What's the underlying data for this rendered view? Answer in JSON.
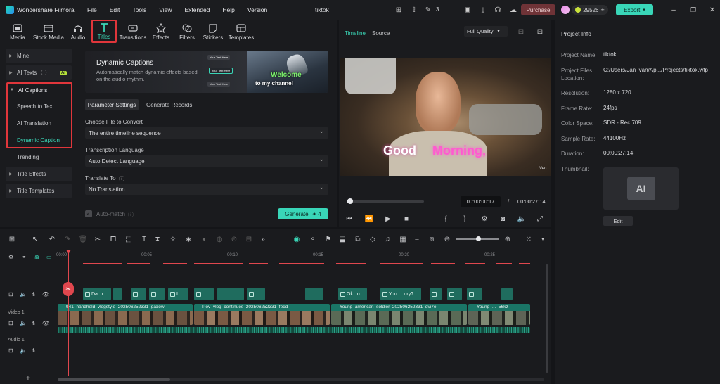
{
  "app": {
    "name": "Wondershare Filmora",
    "project": "tiktok",
    "menus": [
      "File",
      "Edit",
      "Tools",
      "View",
      "Extended",
      "Help",
      "Version"
    ],
    "purchase": "Purchase",
    "credits": "29526",
    "export": "Export",
    "notif_count": "3"
  },
  "toolbar": [
    "Media",
    "Stock Media",
    "Audio",
    "Titles",
    "Transitions",
    "Effects",
    "Filters",
    "Stickers",
    "Templates"
  ],
  "sidebar": {
    "mine": "Mine",
    "ai_texts": "AI Texts",
    "ai_badge": "AI",
    "ai_captions": "AI Captions",
    "sub": [
      "Speech to Text",
      "AI Translation",
      "Dynamic Caption"
    ],
    "trending": "Trending",
    "title_effects": "Title Effects",
    "title_templates": "Title Templates"
  },
  "banner": {
    "title": "Dynamic Captions",
    "desc": "Automatically match dynamic effects based on the audio rhythm.",
    "img_line1": "Welcome",
    "img_line2": "to my channel",
    "mini": [
      "Your Text Here",
      "Your Text Here",
      "Your Text Here"
    ]
  },
  "params": {
    "tab_active": "Parameter Settings",
    "tab_other": "Generate Records",
    "file_label": "Choose File to Convert",
    "file_value": "The entire timeline sequence",
    "lang_label": "Transcription Language",
    "lang_value": "Auto Detect Language",
    "translate_label": "Translate To",
    "translate_value": "No Translation",
    "automatch": "Auto-match",
    "generate": "Generate",
    "gen_cost": "4"
  },
  "preview": {
    "tab_timeline": "Timeline",
    "tab_source": "Source",
    "quality": "Full Quality",
    "caption_a": "Good",
    "caption_b": "Morning,",
    "current": "00:00:00:17",
    "total": "00:00:27:14",
    "separator": "/",
    "watermark": "Veo"
  },
  "info": {
    "title": "Project Info",
    "rows": [
      {
        "k": "Project Name:",
        "v": "tiktok"
      },
      {
        "k": "Project Files Location:",
        "v": "C:/Users/Jan Ivan/Ap.../Projects/tiktok.wfp"
      },
      {
        "k": "Resolution:",
        "v": "1280 x 720"
      },
      {
        "k": "Frame Rate:",
        "v": "24fps"
      },
      {
        "k": "Color Space:",
        "v": "SDR - Rec.709"
      },
      {
        "k": "Sample Rate:",
        "v": "44100Hz"
      },
      {
        "k": "Duration:",
        "v": "00:00:27:14"
      },
      {
        "k": "Thumbnail:",
        "v": ""
      }
    ],
    "edit": "Edit"
  },
  "timeline": {
    "ruler": [
      "00:00",
      "00:05",
      "00:10",
      "00:15",
      "00:20",
      "00:25"
    ],
    "chips": [
      "Da...r",
      "I...",
      "Ok...o",
      "You ....ory?"
    ],
    "video_label": "Video 1",
    "audio_label": "Audio 1",
    "clips": [
      "941_handheld_vlogstyle_202506252331_gaxow",
      "Pov_vlog_continues_202506252331_fe9d",
      "Young_american_soldier_202506252331_dvi7e",
      "Young_..._56kz"
    ]
  }
}
